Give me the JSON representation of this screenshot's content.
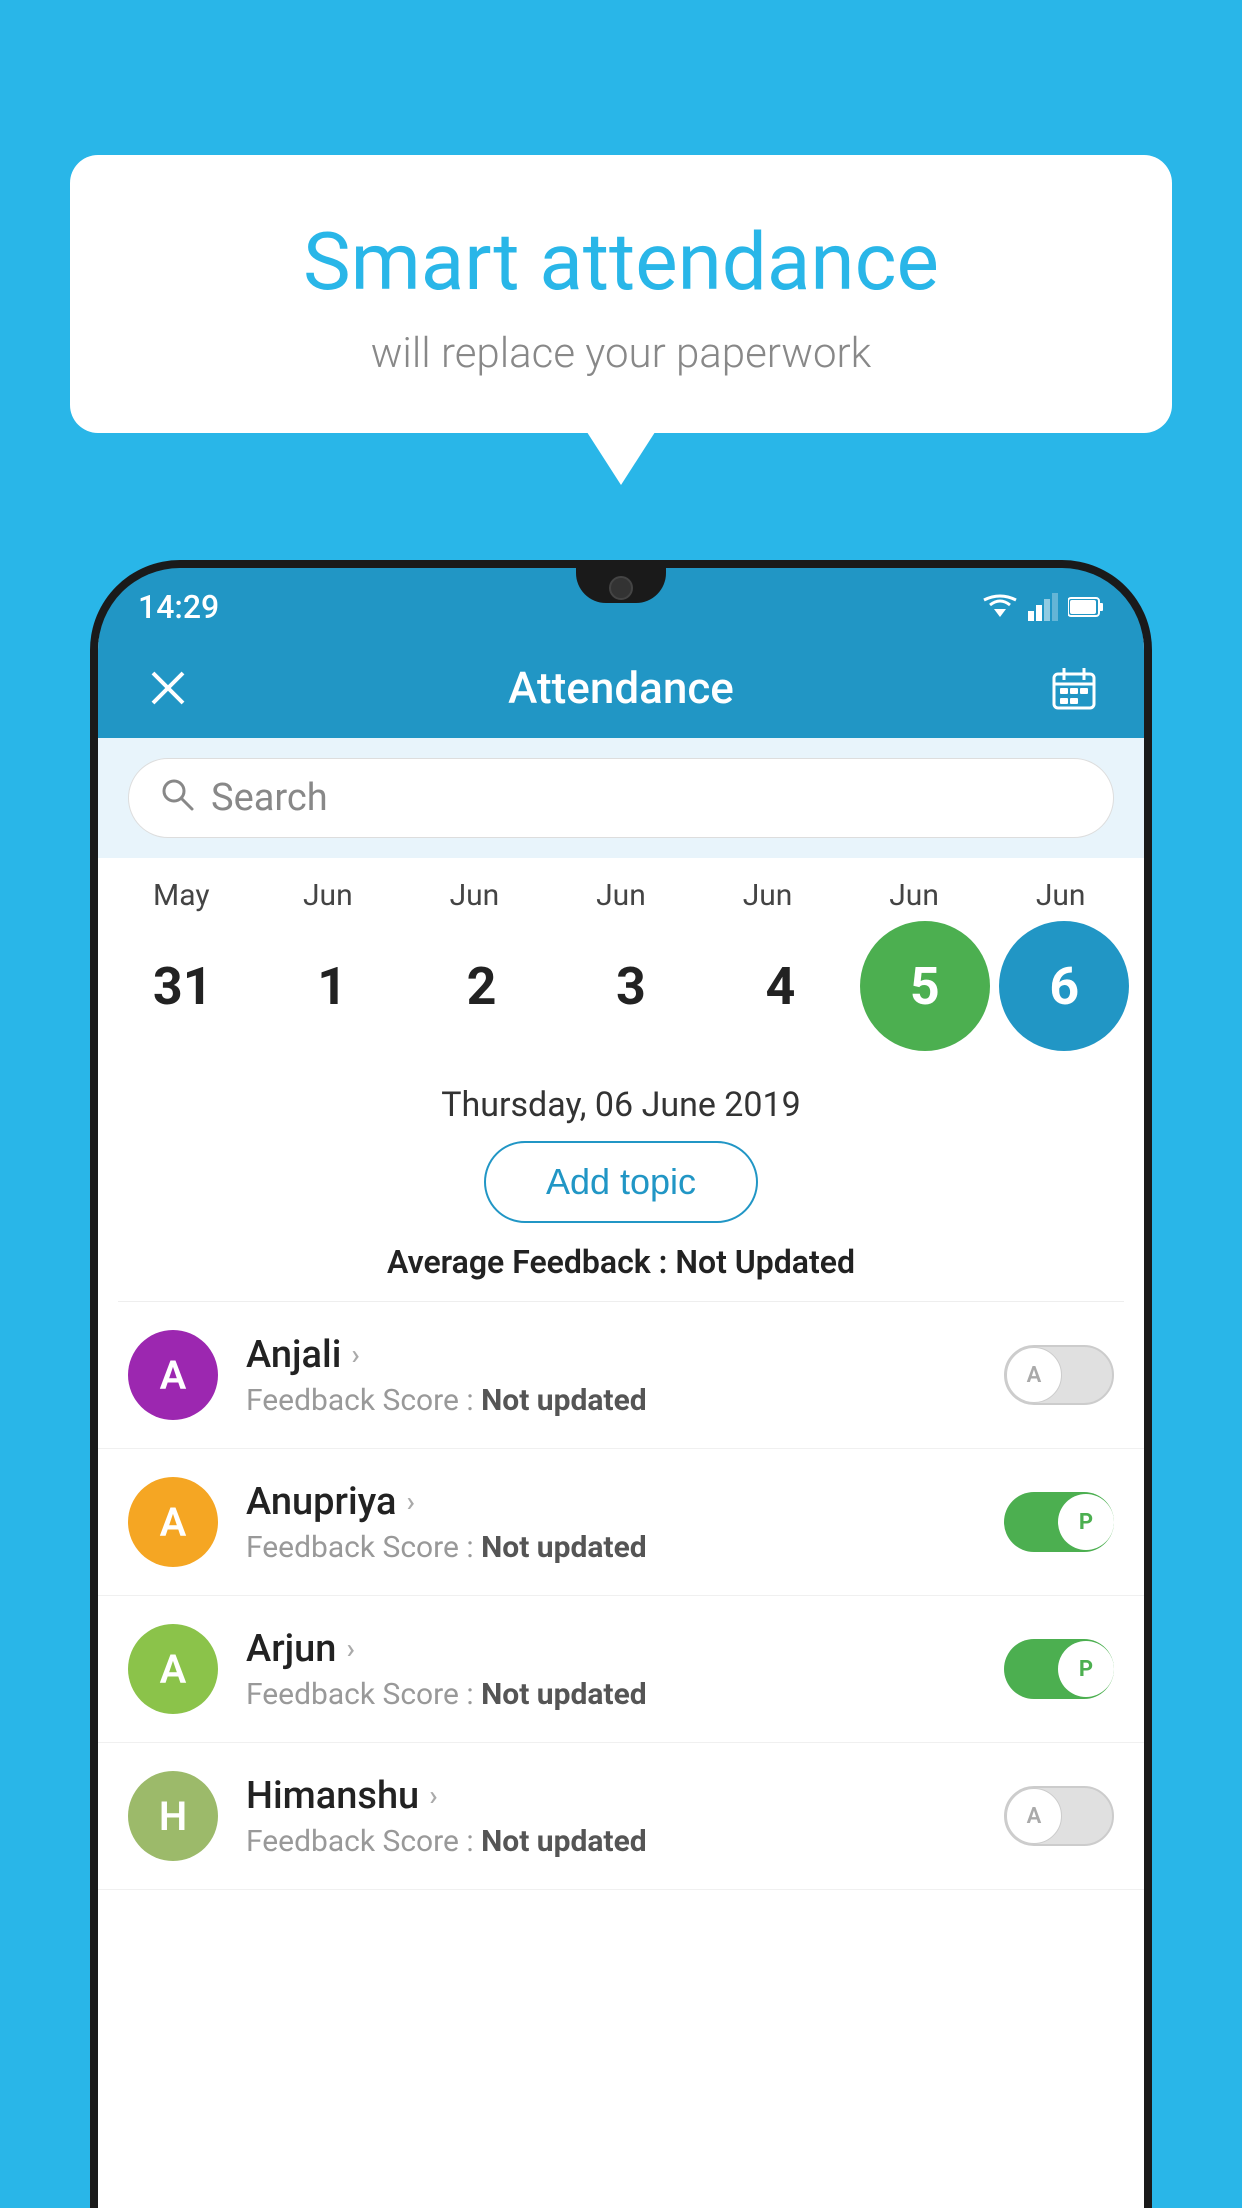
{
  "background_color": "#29b6e8",
  "speech_bubble": {
    "heading": "Smart attendance",
    "subtext": "will replace your paperwork"
  },
  "status_bar": {
    "time": "14:29"
  },
  "app_bar": {
    "title": "Attendance",
    "close_label": "×",
    "calendar_icon": "calendar"
  },
  "search": {
    "placeholder": "Search"
  },
  "calendar": {
    "days": [
      {
        "month": "May",
        "date": "31"
      },
      {
        "month": "Jun",
        "date": "1"
      },
      {
        "month": "Jun",
        "date": "2"
      },
      {
        "month": "Jun",
        "date": "3"
      },
      {
        "month": "Jun",
        "date": "4"
      },
      {
        "month": "Jun",
        "date": "5",
        "state": "today"
      },
      {
        "month": "Jun",
        "date": "6",
        "state": "selected"
      }
    ]
  },
  "selected_date": "Thursday, 06 June 2019",
  "add_topic_label": "Add topic",
  "avg_feedback_label": "Average Feedback : ",
  "avg_feedback_value": "Not Updated",
  "students": [
    {
      "name": "Anjali",
      "avatar_letter": "A",
      "avatar_color": "#9c27b0",
      "feedback_label": "Feedback Score : ",
      "feedback_value": "Not updated",
      "toggle_state": "off",
      "toggle_label": "A"
    },
    {
      "name": "Anupriya",
      "avatar_letter": "A",
      "avatar_color": "#f5a623",
      "feedback_label": "Feedback Score : ",
      "feedback_value": "Not updated",
      "toggle_state": "on",
      "toggle_label": "P"
    },
    {
      "name": "Arjun",
      "avatar_letter": "A",
      "avatar_color": "#8bc34a",
      "feedback_label": "Feedback Score : ",
      "feedback_value": "Not updated",
      "toggle_state": "on",
      "toggle_label": "P"
    },
    {
      "name": "Himanshu",
      "avatar_letter": "H",
      "avatar_color": "#9cba6a",
      "feedback_label": "Feedback Score : ",
      "feedback_value": "Not updated",
      "toggle_state": "off",
      "toggle_label": "A"
    }
  ]
}
